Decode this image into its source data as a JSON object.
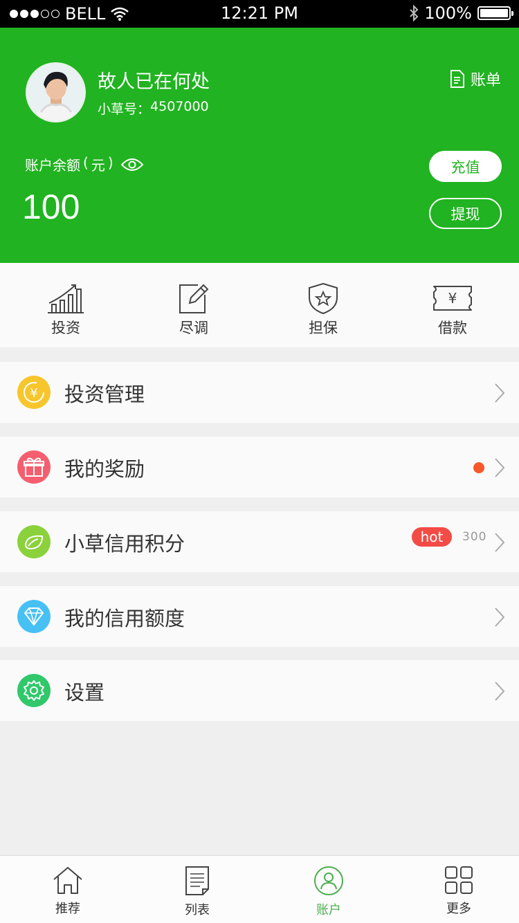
{
  "status_bar": {
    "carrier": "BELL",
    "time": "12:21 PM",
    "battery": "100%"
  },
  "profile": {
    "username": "故人已在何处",
    "id_label": "小草号：",
    "id_value": "4507000",
    "bill_label": "账单"
  },
  "balance": {
    "label": "账户余额",
    "unit": "元",
    "paren_open": "(",
    "paren_close": ")",
    "amount": "100",
    "recharge_label": "充值",
    "withdraw_label": "提现"
  },
  "shortcuts": [
    {
      "label": "投资",
      "icon": "chart-icon"
    },
    {
      "label": "尽调",
      "icon": "edit-icon"
    },
    {
      "label": "担保",
      "icon": "shield-icon"
    },
    {
      "label": "借款",
      "icon": "money-icon"
    }
  ],
  "menu": [
    {
      "label": "投资管理",
      "icon": "yuan-icon",
      "color": "#f7c52c"
    },
    {
      "label": "我的奖励",
      "icon": "gift-icon",
      "color": "#f55e6e",
      "dot_color": "#f7572a"
    },
    {
      "label": "小草信用积分",
      "icon": "leaf-icon",
      "color": "#8bd13b",
      "badge": "hot",
      "score": "300"
    },
    {
      "label": "我的信用额度",
      "icon": "diamond-icon",
      "color": "#47c0f4"
    },
    {
      "label": "设置",
      "icon": "gear-icon",
      "color": "#30c86a"
    }
  ],
  "tabbar": [
    {
      "label": "推荐",
      "icon": "home-icon",
      "active": false
    },
    {
      "label": "列表",
      "icon": "list-icon",
      "active": false
    },
    {
      "label": "账户",
      "icon": "user-icon",
      "active": true
    },
    {
      "label": "更多",
      "icon": "grid-icon",
      "active": false
    }
  ],
  "colors": {
    "brand_green": "#21b321",
    "active_tab": "#4caf50",
    "background": "#efefef"
  }
}
